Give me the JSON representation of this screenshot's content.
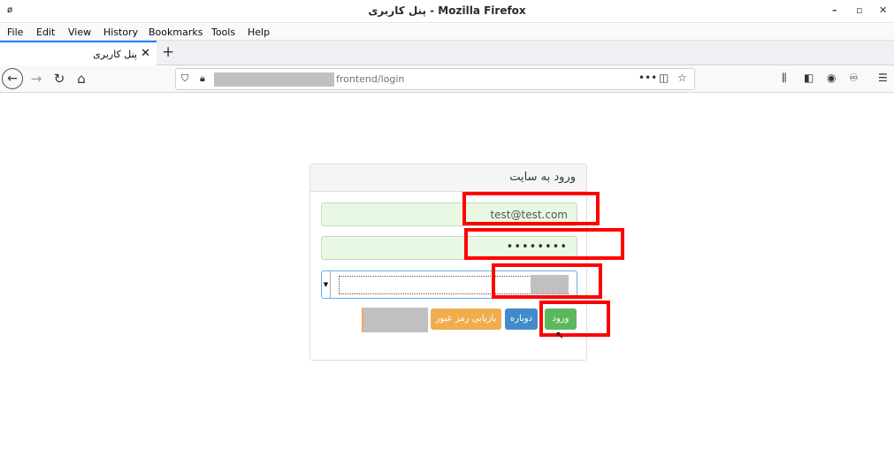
{
  "window": {
    "title": "پنل کاربری - Mozilla Firefox",
    "minimize_icon": "minimize-icon",
    "maximize_icon": "maximize-icon",
    "close_icon": "close-icon"
  },
  "menu": {
    "items": [
      "File",
      "Edit",
      "View",
      "History",
      "Bookmarks",
      "Tools",
      "Help"
    ]
  },
  "tabs": [
    {
      "label": "پنل کاربری",
      "active": true
    }
  ],
  "navbar": {
    "url_visible": "frontend/login",
    "url_masked": true
  },
  "page": {
    "panel_heading": "ورود به سایت",
    "email_value": "test@test.com",
    "password_dots": "••••••••",
    "buttons": {
      "login": "ورود",
      "back": "دوباره",
      "recover": "بازیابی رمز عبور"
    }
  },
  "colors": {
    "login": "#5cb85c",
    "back": "#428bca",
    "recover": "#f0ad4e",
    "highlight": "#ff0000",
    "field_bg": "#e8f8e3"
  }
}
